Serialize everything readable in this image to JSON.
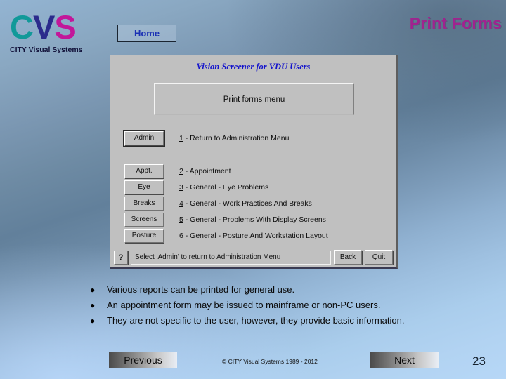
{
  "brand": {
    "logo_c": "C",
    "logo_v": "V",
    "logo_s": "S",
    "tagline": "CITY Visual Systems",
    "color_c": "#119999",
    "color_v": "#2b2b8c",
    "color_s": "#c2179a"
  },
  "nav": {
    "home_label": "Home"
  },
  "header": {
    "title": "Print Forms",
    "title_color": "#a0238f"
  },
  "app": {
    "title": "Vision Screener for VDU Users",
    "menu_panel_label": "Print forms menu",
    "rows": [
      {
        "button": "Admin",
        "key": "1",
        "desc_rest": " - Return to Administration Menu",
        "default": true
      },
      {
        "button": "Appt.",
        "key": "2",
        "desc_rest": " - Appointment",
        "default": false
      },
      {
        "button": "Eye",
        "key": "3",
        "desc_rest": " - General - Eye Problems",
        "default": false
      },
      {
        "button": "Breaks",
        "key": "4",
        "desc_rest": " - General - Work Practices And Breaks",
        "default": false
      },
      {
        "button": "Screens",
        "key": "5",
        "desc_rest": " - General - Problems With Display Screens",
        "default": false
      },
      {
        "button": "Posture",
        "key": "6",
        "desc_rest": " - General - Posture And Workstation Layout",
        "default": false
      }
    ],
    "status": {
      "help_icon": "?",
      "message": "Select 'Admin' to return to Administration Menu",
      "back_label": "Back",
      "quit_label": "Quit"
    }
  },
  "bullets": [
    "Various reports can be printed for general use.",
    "An appointment form may be issued to mainframe or non-PC users.",
    "They are not specific to the user, however, they provide basic information."
  ],
  "footer": {
    "previous_label": "Previous",
    "next_label": "Next",
    "copyright": "© CITY Visual Systems 1989 - 2012",
    "page_number": "23"
  }
}
